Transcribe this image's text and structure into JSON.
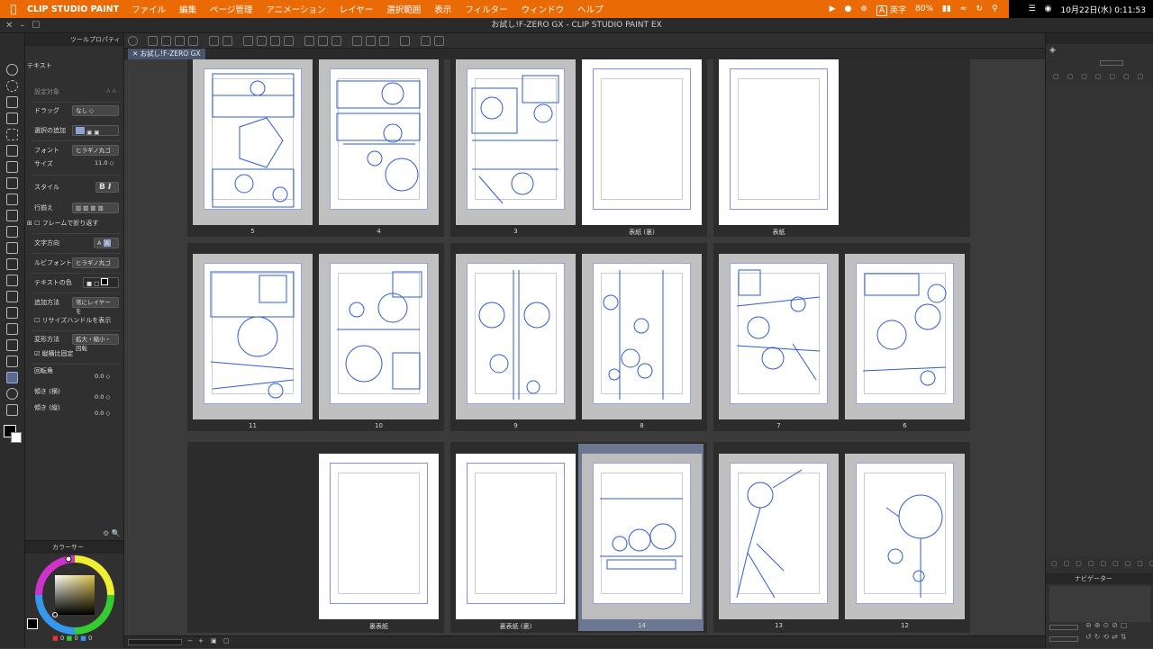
{
  "menubar": {
    "app_name": "CLIP STUDIO PAINT",
    "items": [
      "ファイル",
      "編集",
      "ページ管理",
      "アニメーション",
      "レイヤー",
      "選択範囲",
      "表示",
      "フィルター",
      "ウィンドウ",
      "ヘルプ"
    ],
    "input_source": "英字",
    "battery": "80%",
    "clock": "10月22日(水) 0:11:53",
    "accent_color": "#ea6b06"
  },
  "window": {
    "title": "お試し!F-ZERO GX - CLIP STUDIO PAINT EX",
    "tab_label": "お試し!F-ZERO GX"
  },
  "tool_property": {
    "panel_title": "ツールプロパティ",
    "tool_name": "テキスト",
    "settings_target": "設定対象",
    "drag_label": "ドラッグ",
    "drag_value": "なし",
    "add_selection_label": "選択の追加",
    "font_label": "フォント",
    "font_value": "ヒラギノ丸ゴ",
    "size_label": "サイズ",
    "size_value": "11.0",
    "style_label": "スタイル",
    "align_label": "行揃え",
    "wrap_frame_label": "フレームで折り返す",
    "text_direction_label": "文字方向",
    "ruby_font_label": "ルビフォント",
    "ruby_font_value": "ヒラギノ丸ゴ",
    "text_color_label": "テキストの色",
    "add_method_label": "追加方法",
    "add_method_value": "常にレイヤーを",
    "resize_handle_label": "リサイズハンドルを表示",
    "transform_method_label": "変形方法",
    "transform_method_value": "拡大・縮小・回転",
    "keep_ratio_label": "縦横比固定",
    "rotation_label": "回転角",
    "rotation_value": "0.0",
    "skew_h_label": "傾き (横)",
    "skew_h_value": "0.0",
    "skew_v_label": "傾き (縦)",
    "skew_v_value": "0.0"
  },
  "color_panel": {
    "title": "カラーサー",
    "rgb_r": "0",
    "rgb_g": "0",
    "rgb_b": "0"
  },
  "navigator": {
    "title": "ナビゲーター"
  },
  "pages": {
    "row1": [
      "5",
      "4",
      "3",
      "表紙 (裏)",
      "表紙"
    ],
    "row2": [
      "11",
      "10",
      "9",
      "8",
      "7",
      "6"
    ],
    "row3": [
      "裏表紙",
      "裏表紙 (裏)",
      "14",
      "13",
      "12"
    ]
  }
}
